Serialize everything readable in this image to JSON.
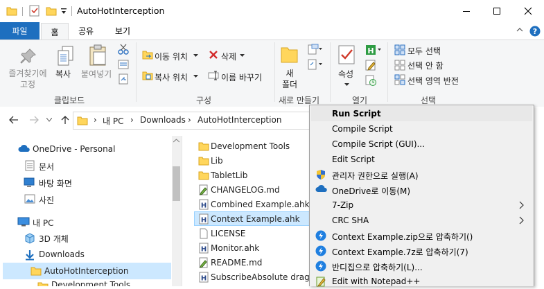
{
  "window": {
    "title": "AutoHotInterception"
  },
  "ribbon": {
    "tabs": {
      "file": "파일",
      "home": "홈",
      "share": "공유",
      "view": "보기"
    },
    "clipboard": {
      "pin": "즐겨찾기에\n고정",
      "copy": "복사",
      "paste": "붙여넣기",
      "group": "클립보드"
    },
    "organize": {
      "move_to": "이동 위치",
      "copy_to": "복사 위치",
      "delete": "삭제",
      "rename": "이름 바꾸기",
      "group": "구성"
    },
    "new": {
      "new_folder": "새\n폴더",
      "group": "새로 만들기"
    },
    "open": {
      "properties": "속성",
      "group": "열기"
    },
    "select": {
      "select_all": "모두 선택",
      "select_none": "선택 안 함",
      "invert": "선택 영역 반전",
      "group": "선택"
    }
  },
  "address": {
    "crumbs": [
      "내 PC",
      "Downloads",
      "AutoHotInterception"
    ]
  },
  "nav": {
    "items": [
      {
        "label": "OneDrive - Personal",
        "icon": "cloud-icon"
      },
      {
        "label": "문서",
        "icon": "document-icon"
      },
      {
        "label": "바탕 화면",
        "icon": "desktop-icon"
      },
      {
        "label": "사진",
        "icon": "picture-icon"
      },
      {
        "label": "내 PC",
        "icon": "pc-icon"
      },
      {
        "label": "3D 개체",
        "icon": "cube-icon"
      },
      {
        "label": "Downloads",
        "icon": "download-icon"
      },
      {
        "label": "AutoHotInterception",
        "icon": "folder-icon"
      },
      {
        "label": "Development Tools",
        "icon": "folder-icon"
      }
    ]
  },
  "files": [
    {
      "name": "Development Tools",
      "icon": "folder-icon"
    },
    {
      "name": "Lib",
      "icon": "folder-icon"
    },
    {
      "name": "TabletLib",
      "icon": "folder-icon"
    },
    {
      "name": "CHANGELOG.md",
      "icon": "markdown-file-icon"
    },
    {
      "name": "Combined Example.ahk",
      "icon": "ahk-file-icon"
    },
    {
      "name": "Context Example.ahk",
      "icon": "ahk-file-icon"
    },
    {
      "name": "LICENSE",
      "icon": "blank-file-icon"
    },
    {
      "name": "Monitor.ahk",
      "icon": "ahk-file-icon"
    },
    {
      "name": "README.md",
      "icon": "markdown-file-icon"
    },
    {
      "name": "SubscribeAbsolute dragging",
      "icon": "ahk-file-icon"
    }
  ],
  "context_menu": {
    "items": [
      {
        "label": "Run Script",
        "bold": true
      },
      {
        "label": "Compile Script"
      },
      {
        "label": "Compile Script (GUI)..."
      },
      {
        "label": "Edit Script"
      },
      {
        "label": "관리자 권한으로 실행(A)",
        "icon": "uac-shield-icon"
      },
      {
        "label": "OneDrive로 이동(M)",
        "icon": "onedrive-icon"
      },
      {
        "label": "7-Zip",
        "submenu": true
      },
      {
        "label": "CRC SHA",
        "submenu": true
      },
      {
        "label": "Context Example.zip으로 압축하기()",
        "icon": "bandizip-icon"
      },
      {
        "label": "Context Example.7z로 압축하기(7)",
        "icon": "bandizip-icon"
      },
      {
        "label": "반디집으로 압축하기(L)...",
        "icon": "bandizip-icon"
      },
      {
        "label": "Edit with Notepad++",
        "icon": "notepadpp-icon"
      }
    ]
  },
  "colors": {
    "accent": "#1e6fbf",
    "selection": "#cce8ff",
    "folder": "#ffd65c"
  }
}
